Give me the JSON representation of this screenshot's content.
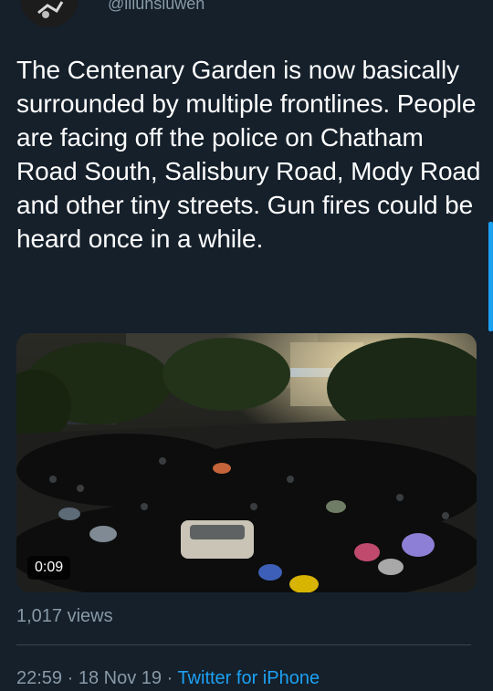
{
  "author": {
    "handle": "@lilunsiuwen"
  },
  "tweet": {
    "text": "The Centenary Garden is now basically surrounded by multiple frontlines. People are facing off the police on Chatham Road South, Salisbury Road, Mody Road and other tiny streets. Gun fires could be heard once in a while."
  },
  "video": {
    "duration": "0:09"
  },
  "stats": {
    "views": "1,017 views"
  },
  "meta": {
    "time": "22:59",
    "date": "18 Nov 19",
    "separator": " · ",
    "source": "Twitter for iPhone"
  },
  "theme": {
    "background": "#15202b",
    "secondary_text": "#8899a6",
    "link": "#1da1f2",
    "divider": "#38444d"
  }
}
